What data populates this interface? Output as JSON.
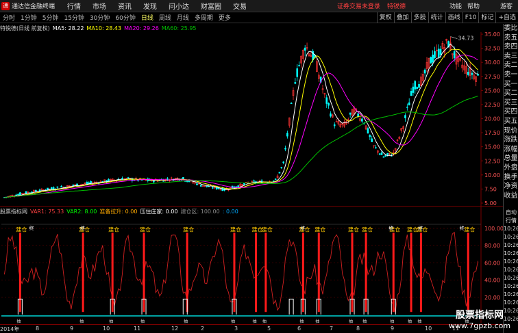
{
  "app": {
    "title": "通达信金融终端",
    "menu": [
      "行情",
      "市场",
      "资讯",
      "发现",
      "问小达",
      "财富圈",
      "交易"
    ],
    "login_status": "证券交易未登录",
    "stock_link": "特锐德",
    "sys": [
      "功能",
      "帮助"
    ],
    "guest": "游客"
  },
  "periods": [
    "分时",
    "1分钟",
    "5分钟",
    "15分钟",
    "30分钟",
    "60分钟",
    "日线",
    "周线",
    "月线",
    "多周期",
    "更多"
  ],
  "active_period": "日线",
  "tools": [
    "复权",
    "叠加",
    "多股",
    "统计",
    "画线",
    "F10",
    "标记",
    "+自选"
  ],
  "info": {
    "name": "特锐德(日线 前复权)",
    "ma5": "MA5: 28.22",
    "ma10": "MA10: 28.43",
    "ma20": "MA20: 29.26",
    "ma60": "MA60: 25.95",
    "high_label": "34.73"
  },
  "sub_info": {
    "name": "股票指标网",
    "var1": "VAR1: 75.33",
    "var2": "VAR2: 8.00",
    "prepare": "准备拉升: 0.00",
    "pressure": "压住庄家: 0.00",
    "build": "建仓区: 100.00",
    "tail": ": 0.00"
  },
  "price_axis": [
    "35.00",
    "32.50",
    "30.00",
    "27.50",
    "25.00",
    "22.50",
    "20.00",
    "17.50",
    "15.00",
    "12.50",
    "10.00",
    "7.50",
    "5.00"
  ],
  "sub_axis": [
    "100.00",
    "80.00",
    "60.00",
    "40.00",
    "20.00"
  ],
  "right_panel": [
    "委比",
    "卖五",
    "卖四",
    "卖三",
    "卖二",
    "卖一",
    "买一",
    "买二",
    "买三",
    "买四",
    "买五",
    "现价",
    "涨跌",
    "涨幅",
    "总量",
    "外盘",
    "换手",
    "净资",
    "收益"
  ],
  "right_panel2": [
    "自动",
    "行情",
    "10:26",
    "10:26",
    "10:26",
    "10:26",
    "10:26",
    "10:26",
    "10:26",
    "10:26",
    "10:26",
    "10:26",
    "10:26",
    "10:26"
  ],
  "x_axis": [
    "2014年",
    "8",
    "9",
    "10",
    "11",
    "12",
    "2",
    "3",
    "5",
    "6",
    "7",
    "8",
    "9",
    "10",
    "11"
  ],
  "signal_label": "建仓",
  "signal_label2": "终",
  "signal_label3": "抽",
  "watermark": {
    "line1": "股票指标网",
    "line2": "www.7gpzb.com"
  },
  "colors": {
    "up": "#ff3333",
    "down": "#00ffff",
    "ma5": "#ffffff",
    "ma10": "#ffff00",
    "ma20": "#ff00ff",
    "ma60": "#00c000",
    "axis": "#7a0000"
  },
  "chart_data": {
    "type": "line",
    "title": "",
    "y_range": [
      5.0,
      35.0
    ],
    "sub_y_range": [
      0,
      100
    ],
    "highest": 34.73
  }
}
